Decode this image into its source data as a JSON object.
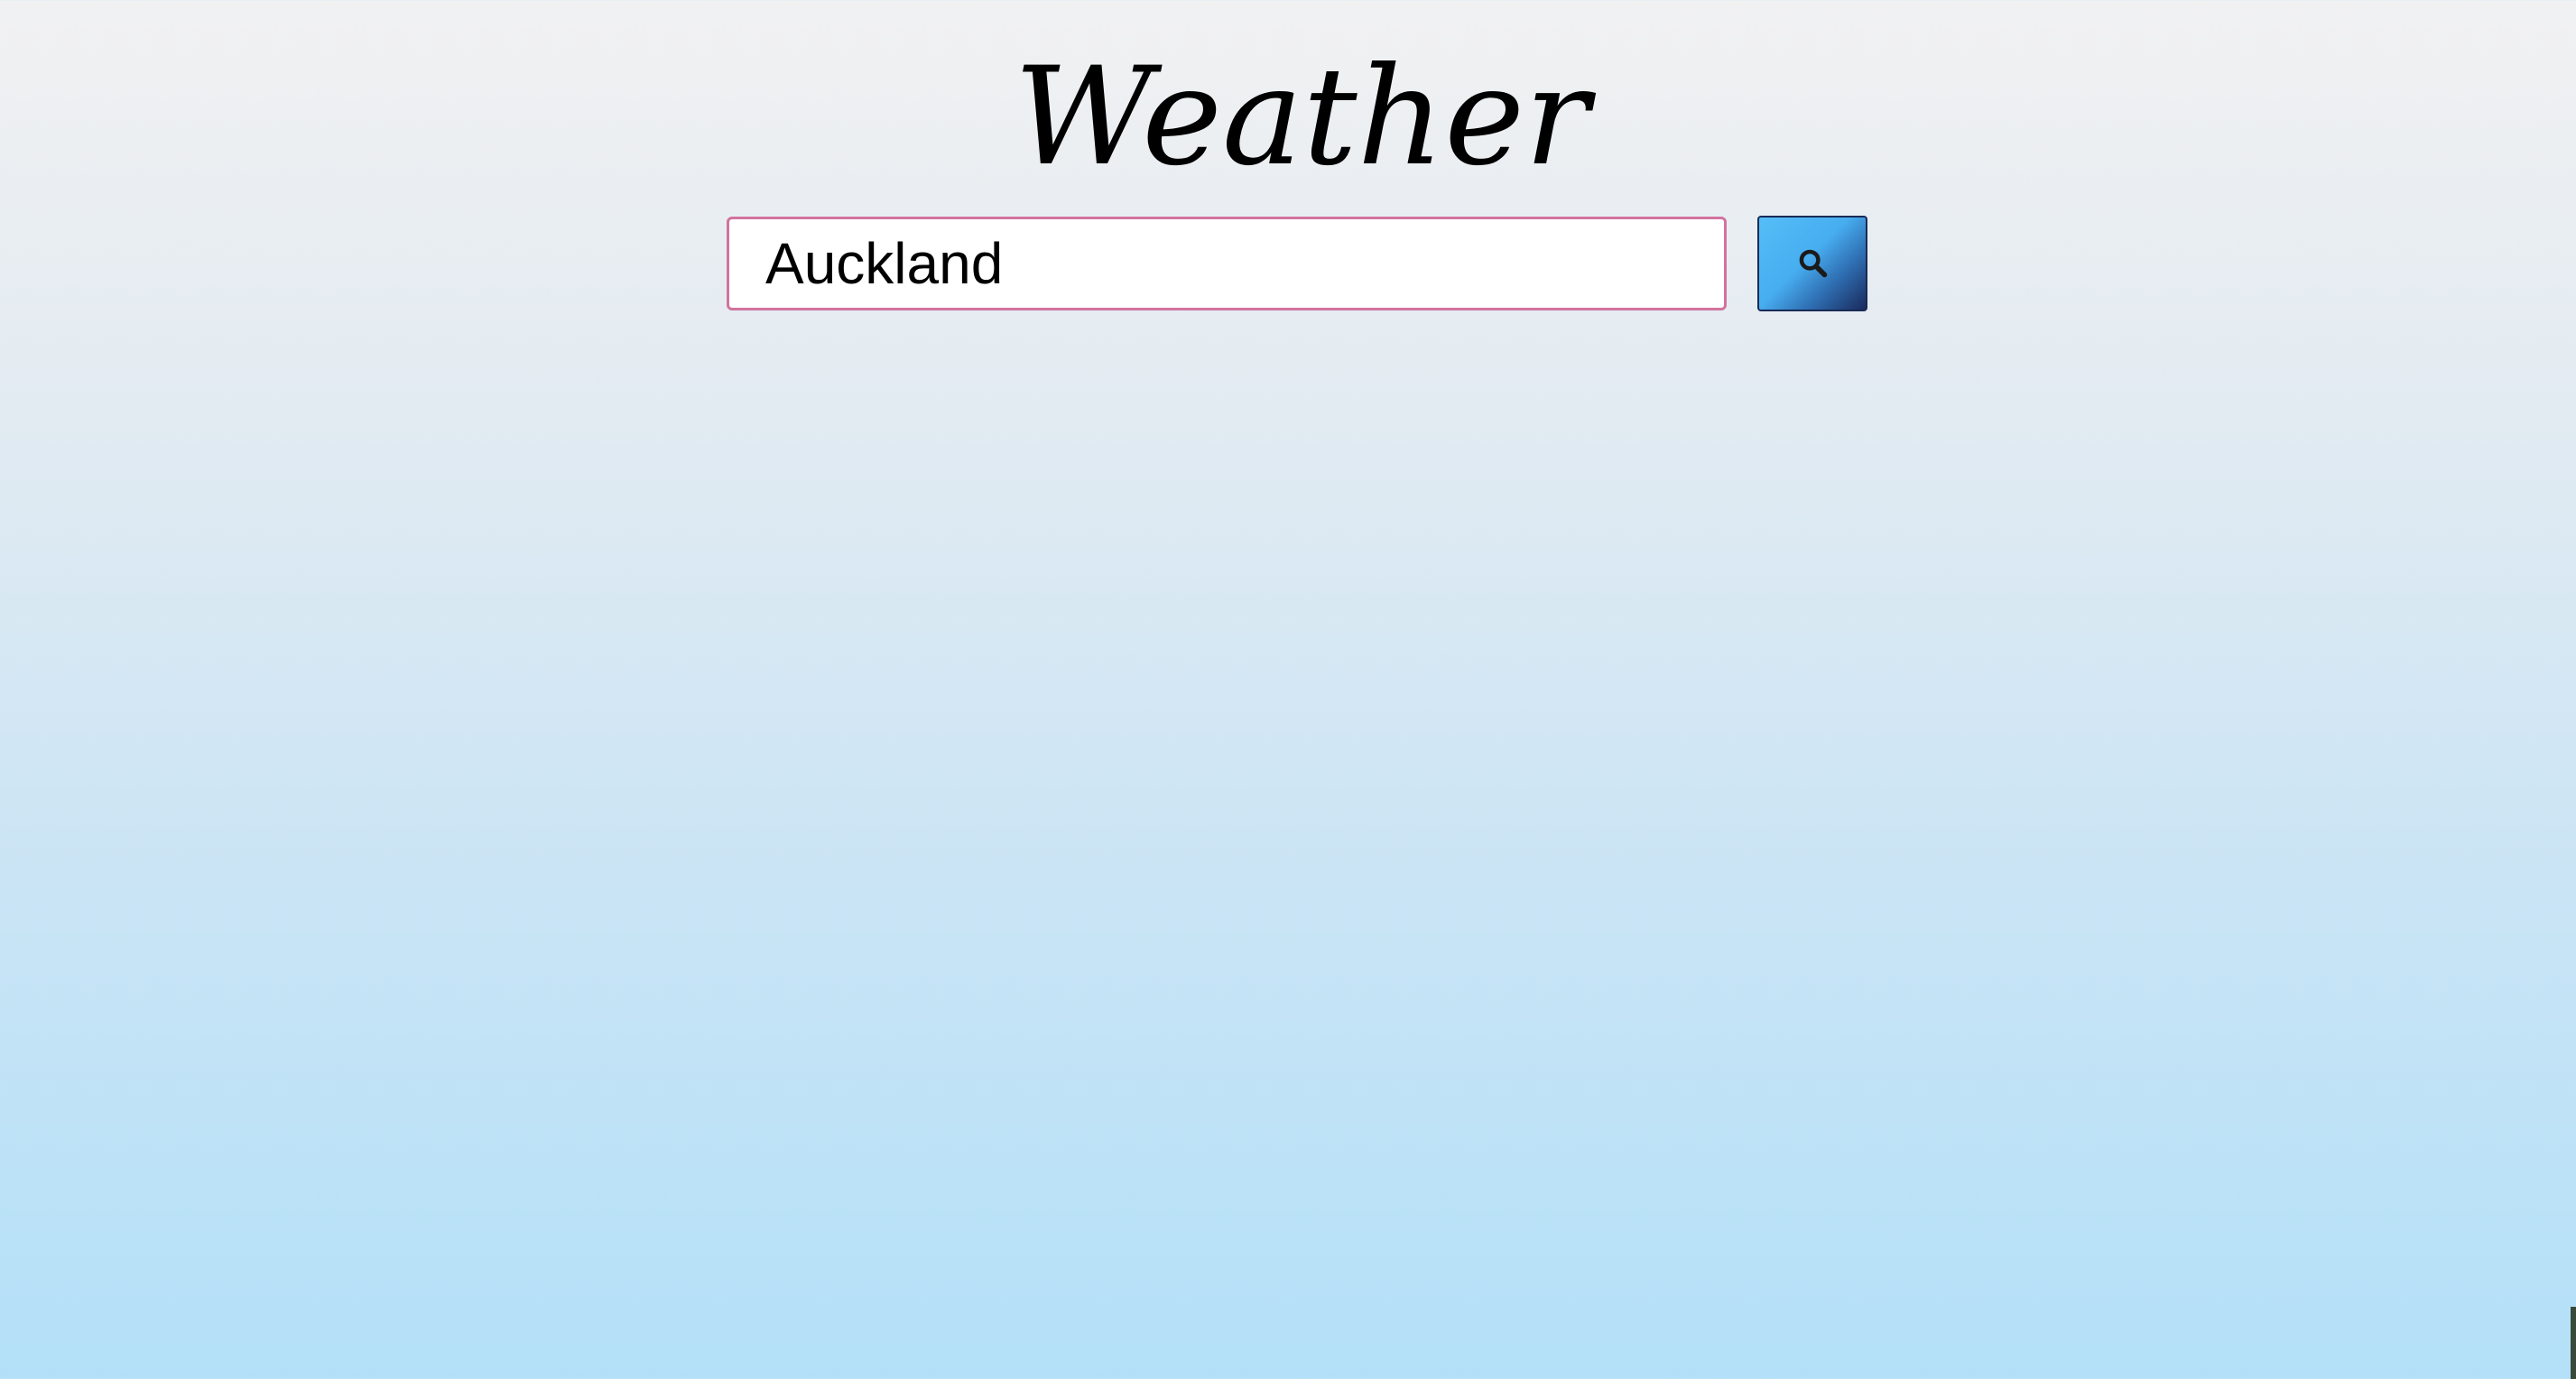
{
  "header": {
    "title": "Weather"
  },
  "search": {
    "value": "Auckland",
    "button_icon": "search-icon"
  },
  "colors": {
    "input_border": "#d2739e",
    "button_gradient_start": "#55bdf7",
    "button_gradient_end": "#1a2a5c",
    "background_top": "#f1f1f2",
    "background_bottom": "#b3e0f8"
  }
}
